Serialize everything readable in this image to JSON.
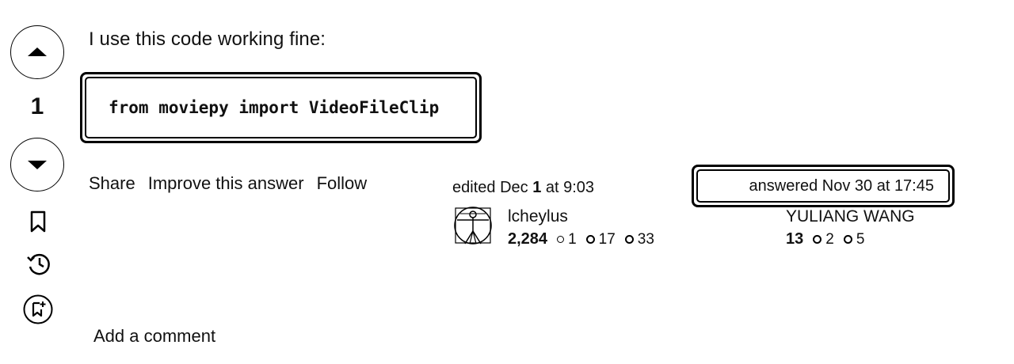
{
  "vote": {
    "count": "1"
  },
  "answer": {
    "intro": "I use this code working fine:",
    "code": "from moviepy import VideoFileClip"
  },
  "post_menu": {
    "share": "Share",
    "improve": "Improve this answer",
    "follow": "Follow"
  },
  "editor": {
    "action": "edited",
    "date": "Dec",
    "day": "1",
    "time_sep": "at 9:03",
    "name": "lcheylus",
    "reputation": "2,284",
    "gold": "1",
    "silver": "17",
    "bronze": "33"
  },
  "author": {
    "answered": "answered Nov 30 at 17:45",
    "name": "YULIANG WANG",
    "reputation": "13",
    "silver": "2",
    "bronze": "5"
  },
  "comments": {
    "add_label": "Add a comment"
  }
}
